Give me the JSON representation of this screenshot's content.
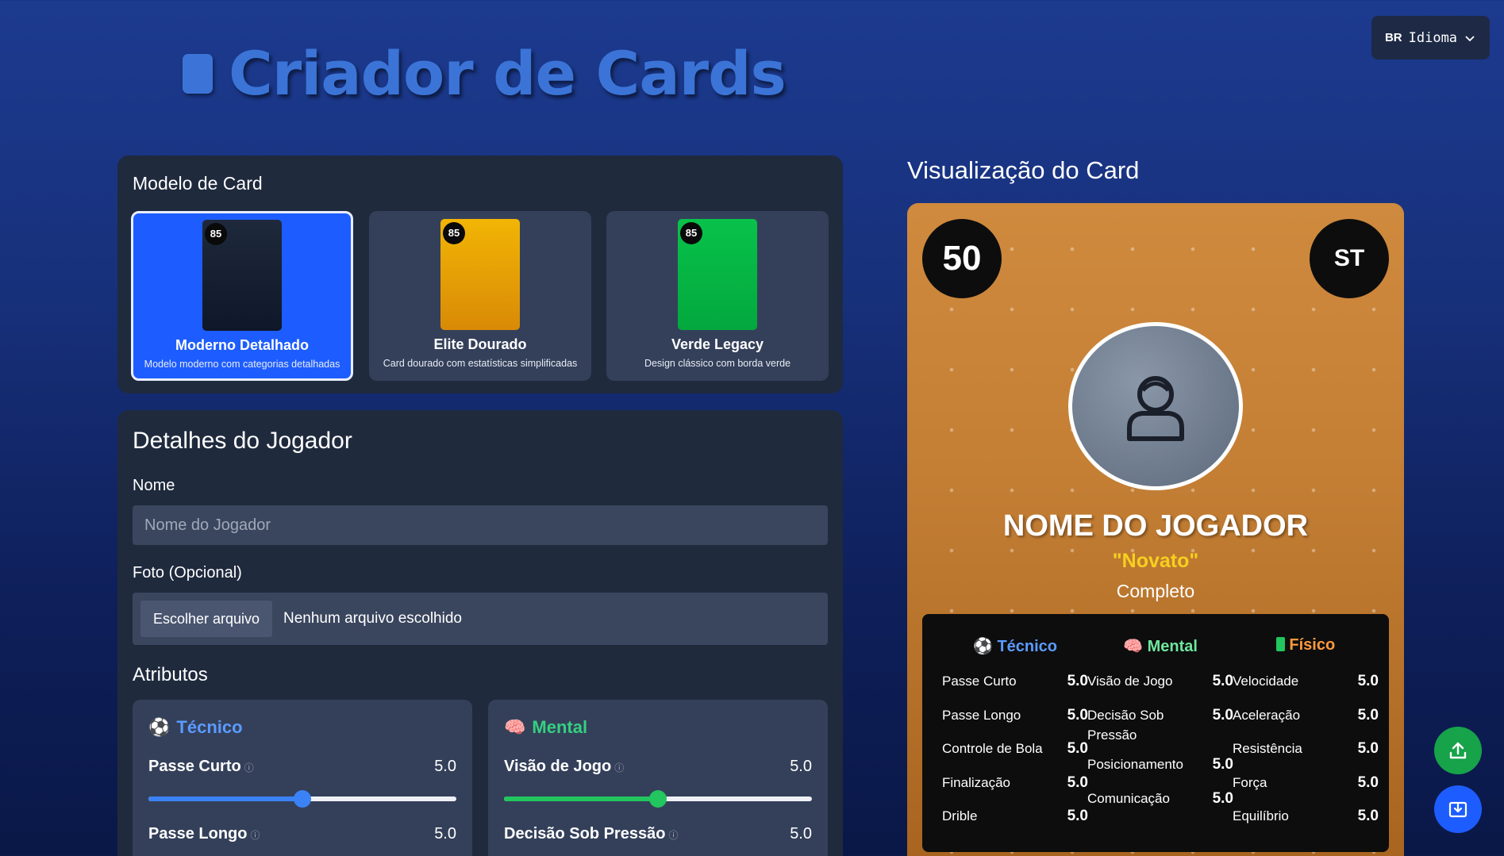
{
  "header": {
    "title": "Criador de Cards"
  },
  "language": {
    "flag": "BR",
    "label": "Idioma"
  },
  "models": {
    "heading": "Modelo de Card",
    "items": [
      {
        "badge": "85",
        "name": "Moderno Detalhado",
        "desc": "Modelo moderno com categorias detalhadas",
        "active": true
      },
      {
        "badge": "85",
        "name": "Elite Dourado",
        "desc": "Card dourado com estatísticas simplificadas",
        "active": false
      },
      {
        "badge": "85",
        "name": "Verde Legacy",
        "desc": "Design clássico com borda verde",
        "active": false
      }
    ]
  },
  "details": {
    "heading": "Detalhes do Jogador",
    "name_label": "Nome",
    "name_placeholder": "Nome do Jogador",
    "photo_label": "Foto (Opcional)",
    "file_button": "Escolher arquivo",
    "file_status": "Nenhum arquivo escolhido",
    "attributes_heading": "Atributos",
    "groups": [
      {
        "title": "Técnico",
        "color": "#5b9bff",
        "rows": [
          {
            "label": "Passe Curto",
            "value": "5.0",
            "fraction": 0.5
          },
          {
            "label": "Passe Longo",
            "value": "5.0",
            "fraction": 0.5
          }
        ]
      },
      {
        "title": "Mental",
        "color": "#35d07f",
        "rows": [
          {
            "label": "Visão de Jogo",
            "value": "5.0",
            "fraction": 0.5
          },
          {
            "label": "Decisão Sob Pressão",
            "value": "5.0",
            "fraction": 0.5
          }
        ]
      }
    ]
  },
  "preview": {
    "heading": "Visualização do Card",
    "rating": "50",
    "position": "ST",
    "player_name": "NOME DO JOGADOR",
    "nickname": "\"Novato\"",
    "role": "Completo",
    "columns": [
      {
        "title": "Técnico",
        "color": "#5b9bff",
        "stats": [
          {
            "name": "Passe Curto",
            "value": "5.0"
          },
          {
            "name": "Passe Longo",
            "value": "5.0"
          },
          {
            "name": "Controle de Bola",
            "value": "5.0"
          },
          {
            "name": "Finalização",
            "value": "5.0"
          },
          {
            "name": "Drible",
            "value": "5.0"
          }
        ]
      },
      {
        "title": "Mental",
        "color": "#6ee7a0",
        "stats": [
          {
            "name": "Visão de Jogo",
            "value": "5.0"
          },
          {
            "name": "Decisão Sob Pressão",
            "value": "5.0"
          },
          {
            "name": "Posicionamento",
            "value": "5.0"
          },
          {
            "name": "Comunicação",
            "value": "5.0"
          }
        ]
      },
      {
        "title": "Físico",
        "color": "#ff9a3c",
        "stats": [
          {
            "name": "Velocidade",
            "value": "5.0"
          },
          {
            "name": "Aceleração",
            "value": "5.0"
          },
          {
            "name": "Resistência",
            "value": "5.0"
          },
          {
            "name": "Força",
            "value": "5.0"
          },
          {
            "name": "Equilíbrio",
            "value": "5.0"
          }
        ]
      }
    ]
  },
  "actions": {
    "upload_color": "#16a34a",
    "download_color": "#1d5dff"
  }
}
